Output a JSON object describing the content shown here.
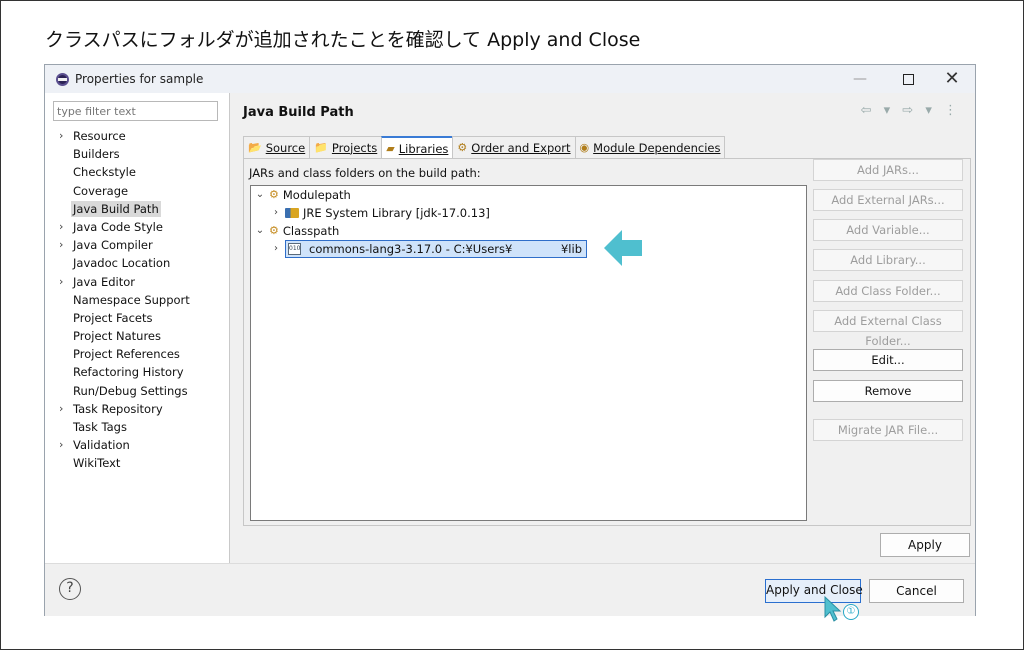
{
  "caption": "クラスパスにフォルダが追加されたことを確認して Apply and Close",
  "window": {
    "title": "Properties for sample",
    "buttons": {
      "minimize": "—",
      "maximize": "",
      "close": "✕"
    }
  },
  "filter": {
    "placeholder": "type filter text"
  },
  "nav": [
    {
      "label": "Resource",
      "expandable": true
    },
    {
      "label": "Builders",
      "expandable": false
    },
    {
      "label": "Checkstyle",
      "expandable": false
    },
    {
      "label": "Coverage",
      "expandable": false
    },
    {
      "label": "Java Build Path",
      "expandable": false,
      "selected": true
    },
    {
      "label": "Java Code Style",
      "expandable": true
    },
    {
      "label": "Java Compiler",
      "expandable": true
    },
    {
      "label": "Javadoc Location",
      "expandable": false
    },
    {
      "label": "Java Editor",
      "expandable": true
    },
    {
      "label": "Namespace Support",
      "expandable": false
    },
    {
      "label": "Project Facets",
      "expandable": false
    },
    {
      "label": "Project Natures",
      "expandable": false
    },
    {
      "label": "Project References",
      "expandable": false
    },
    {
      "label": "Refactoring History",
      "expandable": false
    },
    {
      "label": "Run/Debug Settings",
      "expandable": false
    },
    {
      "label": "Task Repository",
      "expandable": true
    },
    {
      "label": "Task Tags",
      "expandable": false
    },
    {
      "label": "Validation",
      "expandable": true
    },
    {
      "label": "WikiText",
      "expandable": false
    }
  ],
  "page": {
    "title": "Java Build Path",
    "history_arrows": "⇦ ▾ ⇨ ▾ ⋮",
    "tabs": [
      {
        "label": "Source",
        "icon": "source-folder-icon",
        "glyph": "📂"
      },
      {
        "label": "Projects",
        "icon": "projects-icon",
        "glyph": "📁"
      },
      {
        "label": "Libraries",
        "icon": "libraries-icon",
        "glyph": "▰",
        "active": true
      },
      {
        "label": "Order and Export",
        "icon": "order-export-icon",
        "glyph": "⚙"
      },
      {
        "label": "Module Dependencies",
        "icon": "module-deps-icon",
        "glyph": "◉"
      }
    ],
    "body_label": "JARs and class folders on the build path:",
    "tree": {
      "modulepath": "Modulepath",
      "jre": "JRE System Library [jdk-17.0.13]",
      "classpath": "Classpath",
      "selected_entry": "commons-lang3-3.17.0 - C:¥Users¥",
      "selected_entry_suffix": "¥lib"
    },
    "side_buttons": [
      {
        "label": "Add JARs...",
        "enabled": false
      },
      {
        "label": "Add External JARs...",
        "enabled": false
      },
      {
        "label": "Add Variable...",
        "enabled": false
      },
      {
        "label": "Add Library...",
        "enabled": false
      },
      {
        "label": "Add Class Folder...",
        "enabled": false
      },
      {
        "label": "Add External Class Folder...",
        "enabled": false
      },
      {
        "label": "Edit...",
        "enabled": true
      },
      {
        "label": "Remove",
        "enabled": true
      },
      {
        "label": "Migrate JAR File...",
        "enabled": false
      }
    ],
    "apply": "Apply"
  },
  "footer": {
    "help": "?",
    "apply_close": "Apply and Close",
    "cancel": "Cancel"
  },
  "annotations": {
    "arrow_color": "#4fbfcf",
    "step_number": "①"
  }
}
